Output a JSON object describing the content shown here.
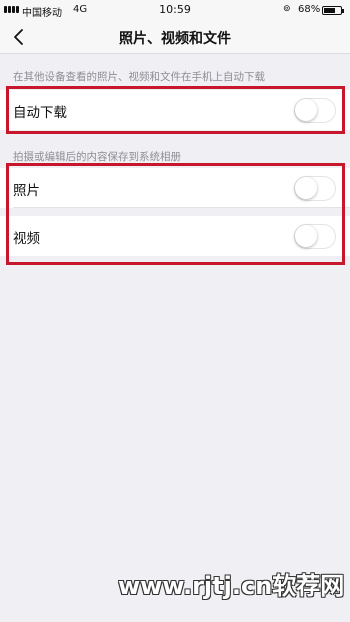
{
  "status_bar": {
    "carrier": "中国移动",
    "network": "4G",
    "time": "10:59",
    "battery": "68%",
    "battery_level": 0.68
  },
  "nav": {
    "back_icon": "chevron-left-icon",
    "title": "照片、视频和文件"
  },
  "sections": [
    {
      "note": "在其他设备查看的照片、视频和文件在手机上自动下载",
      "items": [
        {
          "label": "自动下载",
          "on": false
        }
      ]
    },
    {
      "note": "拍摄或编辑后的内容保存到系统相册",
      "items": [
        {
          "label": "照片",
          "on": false
        },
        {
          "label": "视频",
          "on": false
        }
      ]
    }
  ],
  "colors": {
    "highlight": "#c8172d",
    "background": "#efeff4"
  },
  "watermark": "www.rjtj.cn软荐网"
}
